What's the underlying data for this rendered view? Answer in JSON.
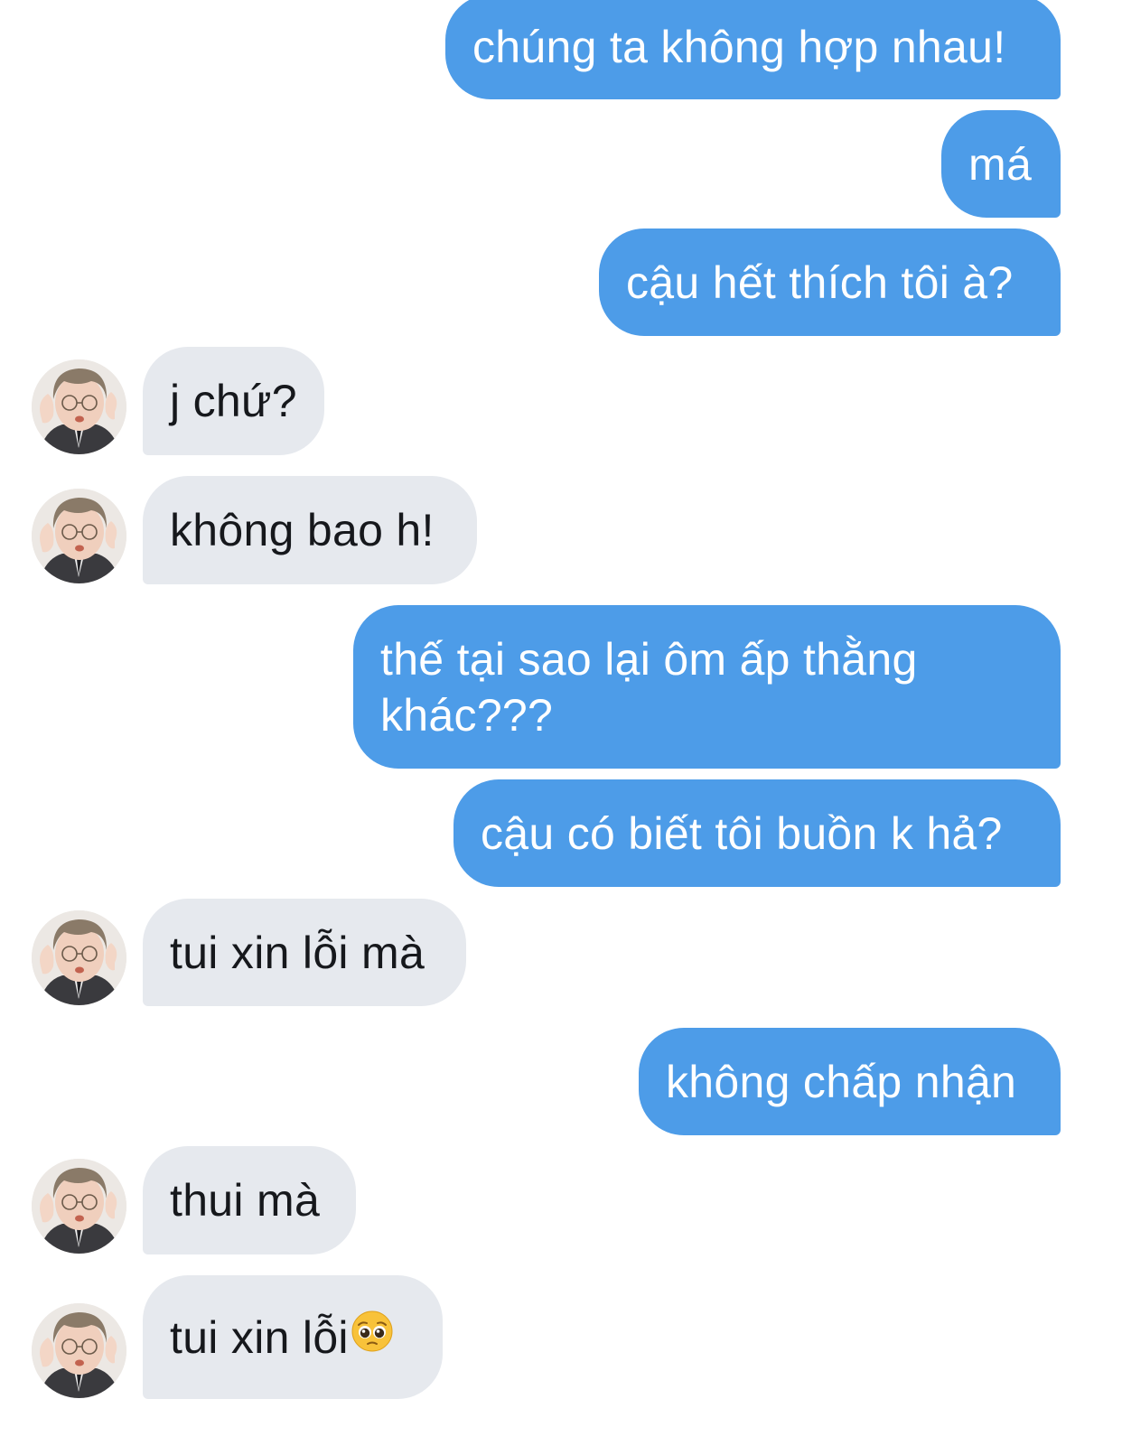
{
  "colors": {
    "sent_bubble": "#4d9ce8",
    "received_bubble": "#e6e9ee",
    "sent_text": "#ffffff",
    "received_text": "#16181c"
  },
  "contact": {
    "avatar_icon": "contact-avatar-photo"
  },
  "messages": [
    {
      "direction": "sent",
      "text": "chúng ta không hợp nhau!"
    },
    {
      "direction": "sent",
      "text": "má"
    },
    {
      "direction": "sent",
      "text": "cậu hết thích tôi à?"
    },
    {
      "direction": "received",
      "text": "j chứ?"
    },
    {
      "direction": "received",
      "text": "không bao h!"
    },
    {
      "direction": "sent",
      "text": "thế tại sao lại ôm ấp thằng khác???"
    },
    {
      "direction": "sent",
      "text": "cậu có biết tôi buồn k hả?"
    },
    {
      "direction": "received",
      "text": "tui xin lỗi mà"
    },
    {
      "direction": "sent",
      "text": "không chấp nhận"
    },
    {
      "direction": "received",
      "text": "thui mà"
    },
    {
      "direction": "received",
      "text": "tui xin lỗi",
      "emoji": "pleading-face-emoji"
    }
  ]
}
